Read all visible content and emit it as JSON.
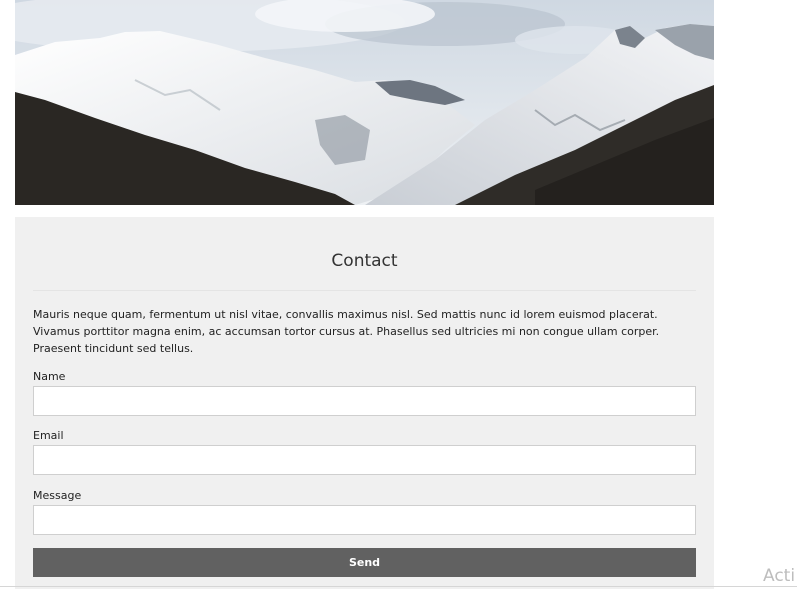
{
  "hero": {
    "image_name": "snowy-mountains-banner"
  },
  "contact": {
    "title": "Contact",
    "intro": "Mauris neque quam, fermentum ut nisl vitae, convallis maximus nisl. Sed mattis nunc id lorem euismod placerat. Vivamus porttitor magna enim, ac accumsan tortor cursus at. Phasellus sed ultricies mi non congue ullam corper. Praesent tincidunt sed tellus.",
    "fields": {
      "name": {
        "label": "Name",
        "value": ""
      },
      "email": {
        "label": "Email",
        "value": ""
      },
      "message": {
        "label": "Message",
        "value": ""
      }
    },
    "send_label": "Send"
  },
  "watermark": {
    "text": "Acti"
  },
  "colors": {
    "panel_bg": "#f0f0f0",
    "button_bg": "#616161",
    "button_text": "#ffffff",
    "field_border": "#cfcfcf"
  }
}
